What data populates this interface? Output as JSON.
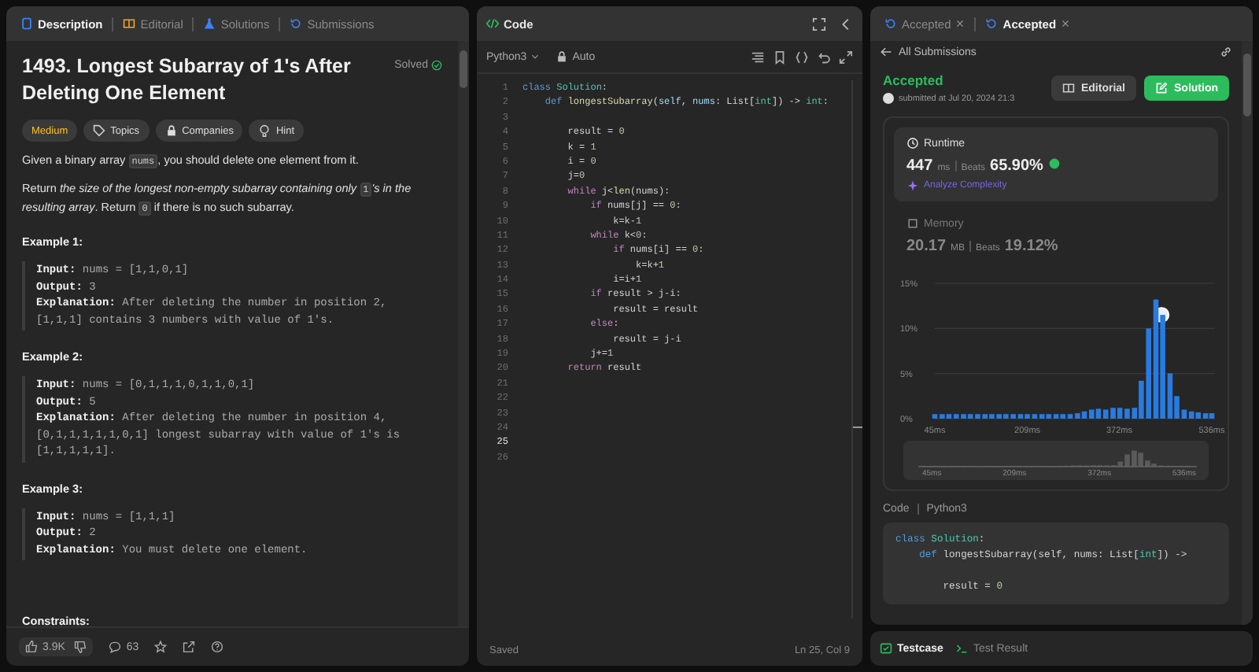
{
  "description_panel": {
    "tabs": [
      {
        "label": "Description",
        "selected": true
      },
      {
        "label": "Editorial",
        "selected": false
      },
      {
        "label": "Solutions",
        "selected": false
      },
      {
        "label": "Submissions",
        "selected": false
      }
    ],
    "title": "1493. Longest Subarray of 1's After Deleting One Element",
    "status": "Solved",
    "tags": [
      "Medium",
      "Topics",
      "Companies",
      "Hint"
    ],
    "paragraphs": [
      [
        {
          "text": "Given a binary array ",
          "kind": "plain"
        },
        {
          "text": "nums",
          "kind": "code"
        },
        {
          "text": ", you should delete one element from it.",
          "kind": "plain"
        }
      ],
      [
        {
          "text": "Return ",
          "kind": "plain"
        },
        {
          "text": "the size of the longest non-empty subarray containing only ",
          "kind": "italic"
        },
        {
          "text": "1",
          "kind": "code"
        },
        {
          "text": "'s in the resulting array",
          "kind": "italic"
        },
        {
          "text": ". Return ",
          "kind": "plain"
        },
        {
          "text": "0",
          "kind": "code"
        },
        {
          "text": " if there is no such subarray.",
          "kind": "plain"
        }
      ]
    ],
    "examples": [
      {
        "title": "Example 1:",
        "input_label": "Input:",
        "input": "nums = [1,1,0,1]",
        "output_label": "Output:",
        "output": "3",
        "explanation_label": "Explanation:",
        "explanation": "After deleting the number in position 2, [1,1,1] contains 3 numbers with value of 1's."
      },
      {
        "title": "Example 2:",
        "input_label": "Input:",
        "input": "nums = [0,1,1,1,0,1,1,0,1]",
        "output_label": "Output:",
        "output": "5",
        "explanation_label": "Explanation:",
        "explanation": "After deleting the number in position 4, [0,1,1,1,1,1,0,1] longest subarray with value of 1's is [1,1,1,1,1]."
      },
      {
        "title": "Example 3:",
        "input_label": "Input:",
        "input": "nums = [1,1,1]",
        "output_label": "Output:",
        "output": "2",
        "explanation_label": "Explanation:",
        "explanation": "You must delete one element."
      }
    ],
    "constraints_title": "Constraints:",
    "footer": {
      "likes": "3.9K",
      "comments": "63"
    }
  },
  "code_panel": {
    "title": "Code",
    "language": "Python3",
    "mode": "Auto",
    "lines": [
      {
        "num": "1",
        "current": false,
        "tokens": [
          {
            "text": "class",
            "kind": "kw"
          },
          {
            "text": " Solution",
            "kind": "cls"
          },
          {
            "text": ":",
            "kind": "plain"
          }
        ]
      },
      {
        "num": "2",
        "current": false,
        "tokens": [
          {
            "text": "    def",
            "kind": "kw"
          },
          {
            "text": " longestSubarray",
            "kind": "fn"
          },
          {
            "text": "(",
            "kind": "plain"
          },
          {
            "text": "self",
            "kind": "param"
          },
          {
            "text": ", ",
            "kind": "plain"
          },
          {
            "text": "nums",
            "kind": "param"
          },
          {
            "text": ": List[",
            "kind": "plain"
          },
          {
            "text": "int",
            "kind": "cls"
          },
          {
            "text": "]) -> ",
            "kind": "plain"
          },
          {
            "text": "int",
            "kind": "cls"
          },
          {
            "text": ":",
            "kind": "plain"
          }
        ]
      },
      {
        "num": "3",
        "current": false
      },
      {
        "num": "4",
        "current": false,
        "tokens": [
          {
            "text": "        result = ",
            "kind": "plain"
          },
          {
            "text": "0",
            "kind": "num"
          }
        ]
      },
      {
        "num": "5",
        "current": false,
        "tokens": [
          {
            "text": "        k = ",
            "kind": "plain"
          },
          {
            "text": "1",
            "kind": "num"
          }
        ]
      },
      {
        "num": "6",
        "current": false,
        "tokens": [
          {
            "text": "        i = ",
            "kind": "plain"
          },
          {
            "text": "0",
            "kind": "num"
          }
        ]
      },
      {
        "num": "7",
        "current": false,
        "tokens": [
          {
            "text": "        j=",
            "kind": "plain"
          },
          {
            "text": "0",
            "kind": "num"
          }
        ]
      },
      {
        "num": "8",
        "current": false,
        "tokens": [
          {
            "text": "        while",
            "kind": "ctrl"
          },
          {
            "text": " j<",
            "kind": "plain"
          },
          {
            "text": "len",
            "kind": "fn"
          },
          {
            "text": "(nums):",
            "kind": "plain"
          }
        ]
      },
      {
        "num": "9",
        "current": false,
        "tokens": [
          {
            "text": "            if",
            "kind": "ctrl"
          },
          {
            "text": " nums[j] == ",
            "kind": "plain"
          },
          {
            "text": "0",
            "kind": "num"
          },
          {
            "text": ":",
            "kind": "plain"
          }
        ]
      },
      {
        "num": "10",
        "current": false,
        "tokens": [
          {
            "text": "                k=k-",
            "kind": "plain"
          },
          {
            "text": "1",
            "kind": "num"
          }
        ]
      },
      {
        "num": "11",
        "current": false,
        "tokens": [
          {
            "text": "            while",
            "kind": "ctrl"
          },
          {
            "text": " k<",
            "kind": "plain"
          },
          {
            "text": "0",
            "kind": "num"
          },
          {
            "text": ":",
            "kind": "plain"
          }
        ]
      },
      {
        "num": "12",
        "current": false,
        "tokens": [
          {
            "text": "                if",
            "kind": "ctrl"
          },
          {
            "text": " nums[i] == ",
            "kind": "plain"
          },
          {
            "text": "0",
            "kind": "num"
          },
          {
            "text": ":",
            "kind": "plain"
          }
        ]
      },
      {
        "num": "13",
        "current": false,
        "tokens": [
          {
            "text": "                    k=k+",
            "kind": "plain"
          },
          {
            "text": "1",
            "kind": "num"
          }
        ]
      },
      {
        "num": "14",
        "current": false,
        "tokens": [
          {
            "text": "                i=i+",
            "kind": "plain"
          },
          {
            "text": "1",
            "kind": "num"
          }
        ]
      },
      {
        "num": "15",
        "current": false,
        "tokens": [
          {
            "text": "            if",
            "kind": "ctrl"
          },
          {
            "text": " result > j-i:",
            "kind": "plain"
          }
        ]
      },
      {
        "num": "16",
        "current": false,
        "tokens": [
          {
            "text": "                result = result",
            "kind": "plain"
          }
        ]
      },
      {
        "num": "17",
        "current": false,
        "tokens": [
          {
            "text": "            else",
            "kind": "ctrl"
          },
          {
            "text": ":",
            "kind": "plain"
          }
        ]
      },
      {
        "num": "18",
        "current": false,
        "tokens": [
          {
            "text": "                result = j-i",
            "kind": "plain"
          }
        ]
      },
      {
        "num": "19",
        "current": false,
        "tokens": [
          {
            "text": "            j+=",
            "kind": "plain"
          },
          {
            "text": "1",
            "kind": "num"
          }
        ]
      },
      {
        "num": "20",
        "current": false,
        "tokens": [
          {
            "text": "        return",
            "kind": "ctrl"
          },
          {
            "text": " result",
            "kind": "plain"
          }
        ]
      },
      {
        "num": "21",
        "current": false
      },
      {
        "num": "22",
        "current": false
      },
      {
        "num": "23",
        "current": false
      },
      {
        "num": "24",
        "current": false
      },
      {
        "num": "25",
        "current": true
      },
      {
        "num": "26",
        "current": false
      }
    ],
    "status_left": "Saved",
    "status_right": "Ln 25, Col 9"
  },
  "result_panel": {
    "tabs": [
      {
        "label": "Accepted",
        "selected": false
      },
      {
        "label": "Accepted",
        "selected": true
      }
    ],
    "back_link": "All Submissions",
    "verdict": "Accepted",
    "submitted": "submitted at Jul 20, 2024 21:3",
    "buttons": [
      "Editorial",
      "Solution"
    ],
    "runtime": {
      "title": "Runtime",
      "value": "447",
      "unit": "ms",
      "beats_label": "Beats",
      "beats": "65.90%",
      "analyze": "Analyze Complexity"
    },
    "memory": {
      "title": "Memory",
      "value": "20.17",
      "unit": "MB",
      "beats_label": "Beats",
      "beats": "19.12%"
    },
    "chart_data": {
      "type": "bar",
      "ylim": [
        0,
        15
      ],
      "xlim": [
        45,
        536
      ],
      "yticks": [
        {
          "value": 0,
          "label": "0%"
        },
        {
          "value": 5,
          "label": "5%"
        },
        {
          "value": 10,
          "label": "10%"
        },
        {
          "value": 15,
          "label": "15%"
        }
      ],
      "xticks": [
        {
          "value": 45,
          "label": "45ms"
        },
        {
          "value": 209,
          "label": "209ms"
        },
        {
          "value": 372,
          "label": "372ms"
        },
        {
          "value": 536,
          "label": "536ms"
        }
      ],
      "x": [
        45,
        58,
        70,
        83,
        96,
        108,
        121,
        134,
        146,
        159,
        171,
        184,
        197,
        209,
        222,
        235,
        247,
        260,
        272,
        285,
        298,
        310,
        323,
        335,
        348,
        361,
        373,
        386,
        399,
        411,
        424,
        437,
        449,
        462,
        474,
        487,
        500,
        512,
        525,
        536
      ],
      "series": [
        {
          "color": "#2a7be0",
          "values": [
            0.5,
            0.5,
            0.5,
            0.5,
            0.5,
            0.5,
            0.5,
            0.5,
            0.5,
            0.5,
            0.5,
            0.5,
            0.5,
            0.5,
            0.5,
            0.5,
            0.5,
            0.5,
            0.5,
            0.5,
            0.6,
            0.8,
            1,
            1.1,
            1,
            1.2,
            1.2,
            1.1,
            1.2,
            4.2,
            10,
            13.2,
            11.5,
            5,
            2.5,
            1,
            0.8,
            0.7,
            0.6,
            0.6
          ]
        }
      ]
    },
    "minimap_labels": [
      "45ms",
      "209ms",
      "372ms",
      "536ms"
    ],
    "code_label": "Code",
    "code_language": "Python3",
    "code_lines": [
      {
        "blank": false,
        "tokens": [
          {
            "text": "class",
            "kind": "kw"
          },
          {
            "text": " Solution",
            "kind": "cls"
          },
          {
            "text": ":",
            "kind": "plain"
          }
        ]
      },
      {
        "blank": false,
        "tokens": [
          {
            "text": "    def",
            "kind": "kw"
          },
          {
            "text": " longestSubarray(self, nums: List[",
            "kind": "plain"
          },
          {
            "text": "int",
            "kind": "cls"
          },
          {
            "text": "]) ->",
            "kind": "plain"
          }
        ]
      },
      {
        "blank": true
      },
      {
        "blank": false,
        "tokens": [
          {
            "text": "        result = ",
            "kind": "plain"
          },
          {
            "text": "0",
            "kind": "num"
          }
        ]
      }
    ]
  },
  "bottom_tabs": [
    {
      "label": "Testcase",
      "selected": true
    },
    {
      "label": "Test Result",
      "selected": false
    }
  ]
}
